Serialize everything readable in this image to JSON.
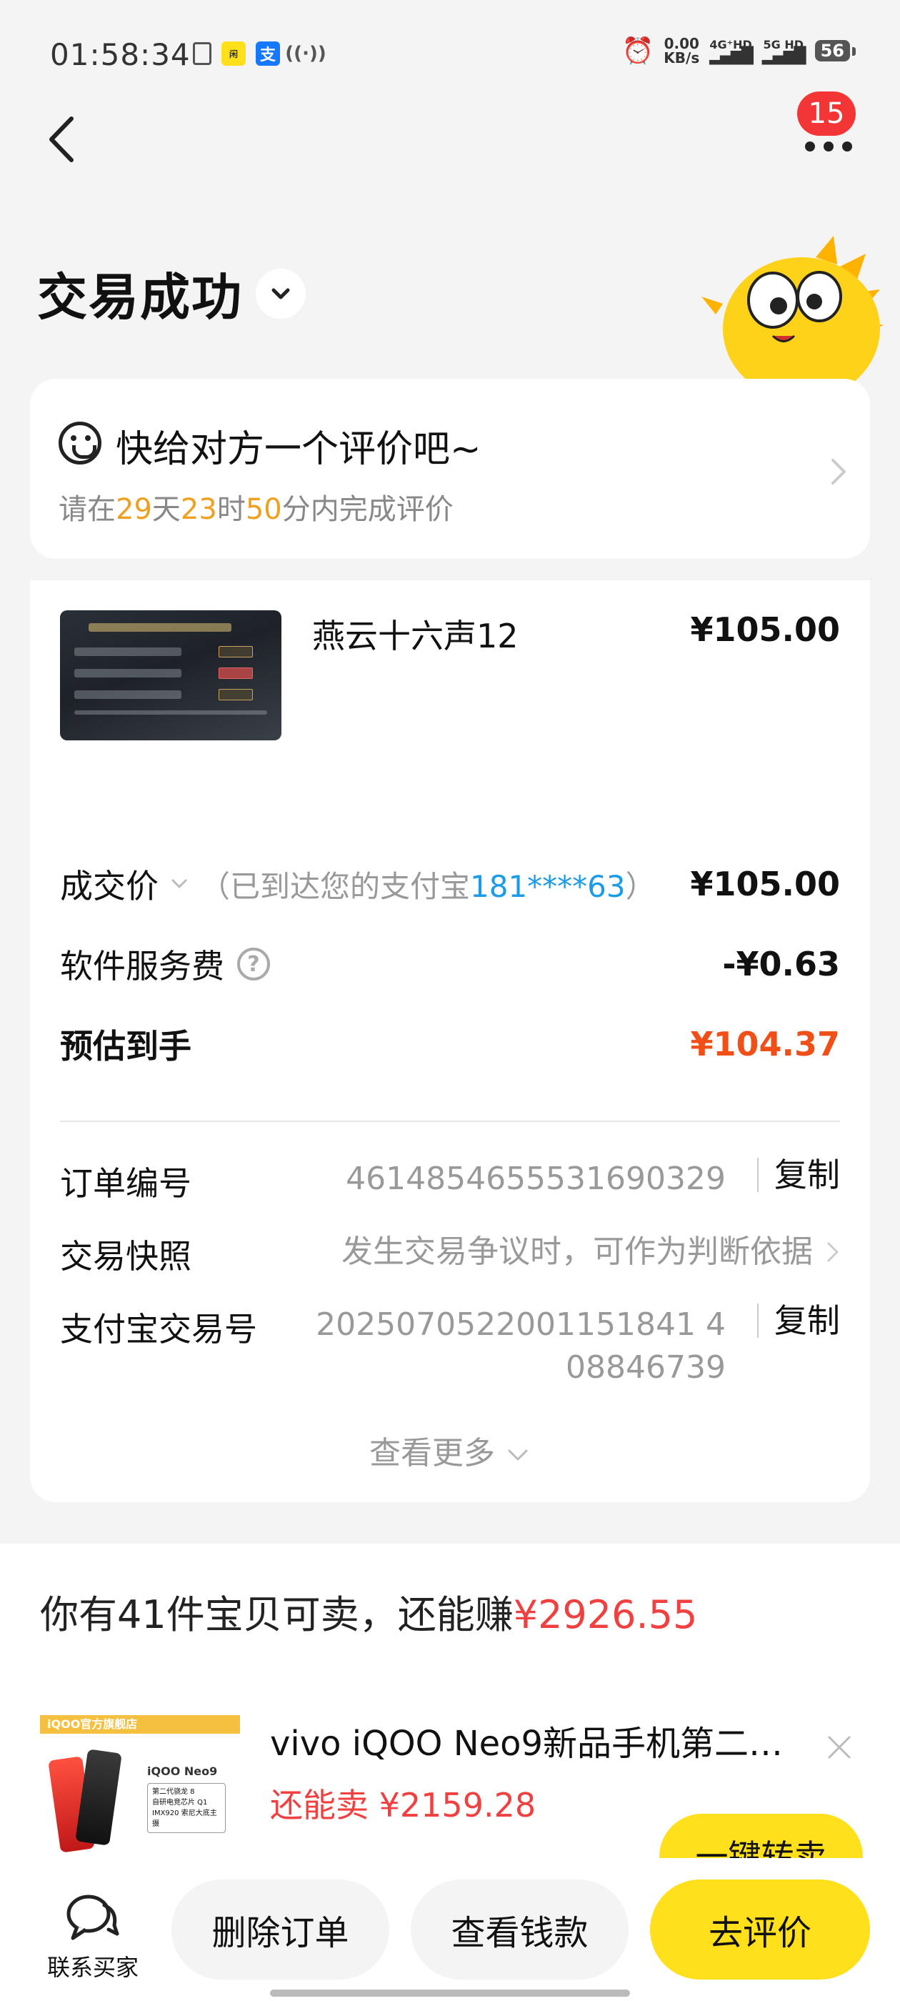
{
  "status_bar": {
    "time": "01:58:34",
    "net_speed_value": "0.00",
    "net_speed_unit": "KB/s",
    "net_1": "4G⁺HD",
    "net_2": "5G HD",
    "battery": "56",
    "icons": [
      "file-icon",
      "xianyu-app-icon",
      "alipay-icon",
      "nfc-icon",
      "alarm-icon",
      "signal-icon"
    ]
  },
  "nav": {
    "badge_count": "15"
  },
  "header": {
    "title": "交易成功"
  },
  "review": {
    "title": "快给对方一个评价吧~",
    "prefix": "请在",
    "days": "29",
    "days_unit": "天",
    "hours": "23",
    "hours_unit": "时",
    "minutes": "50",
    "minutes_unit": "分内完成评价"
  },
  "order": {
    "product_name": "燕云十六声12",
    "product_price": "¥105.00",
    "deal_price_label": "成交价",
    "deal_note_prefix": "（已到达您的支付宝",
    "deal_note_account": "181****63",
    "deal_note_suffix": "）",
    "deal_price": "¥105.00",
    "service_fee_label": "软件服务费",
    "service_fee": "-¥0.63",
    "estimated_label": "预估到手",
    "estimated": "¥104.37",
    "order_no_label": "订单编号",
    "order_no": "4614854655531690329",
    "copy_label": "复制",
    "snapshot_label": "交易快照",
    "snapshot_value": "发生交易争议时，可作为判断依据",
    "alipay_no_label": "支付宝交易号",
    "alipay_no_line1": "2025070522001151841 4",
    "alipay_no_line2": "08846739",
    "more_label": "查看更多"
  },
  "sell": {
    "title_prefix": "你有41件宝贝可卖，还能赚",
    "title_amount": "¥2926.55",
    "item_name": "vivo iQOO Neo9新品手机第二…",
    "item_price": "还能卖 ¥2159.28",
    "resell_label": "一键转卖",
    "thumb_banner": "iQOO官方旗舰店",
    "thumb_model": "iQOO Neo9",
    "thumb_spec1": "第二代骁龙 8",
    "thumb_spec2": "自研电竞芯片 Q1",
    "thumb_spec3": "IMX920 索尼大底主摄"
  },
  "bottom": {
    "contact_label": "联系买家",
    "delete_label": "删除订单",
    "money_label": "查看钱款",
    "review_label": "去评价"
  },
  "colors": {
    "accent_yellow": "#ffe01a",
    "price_orange": "#f05018",
    "countdown_orange": "#f0a020",
    "link_blue": "#1b9ce8",
    "badge_red": "#f43535"
  }
}
